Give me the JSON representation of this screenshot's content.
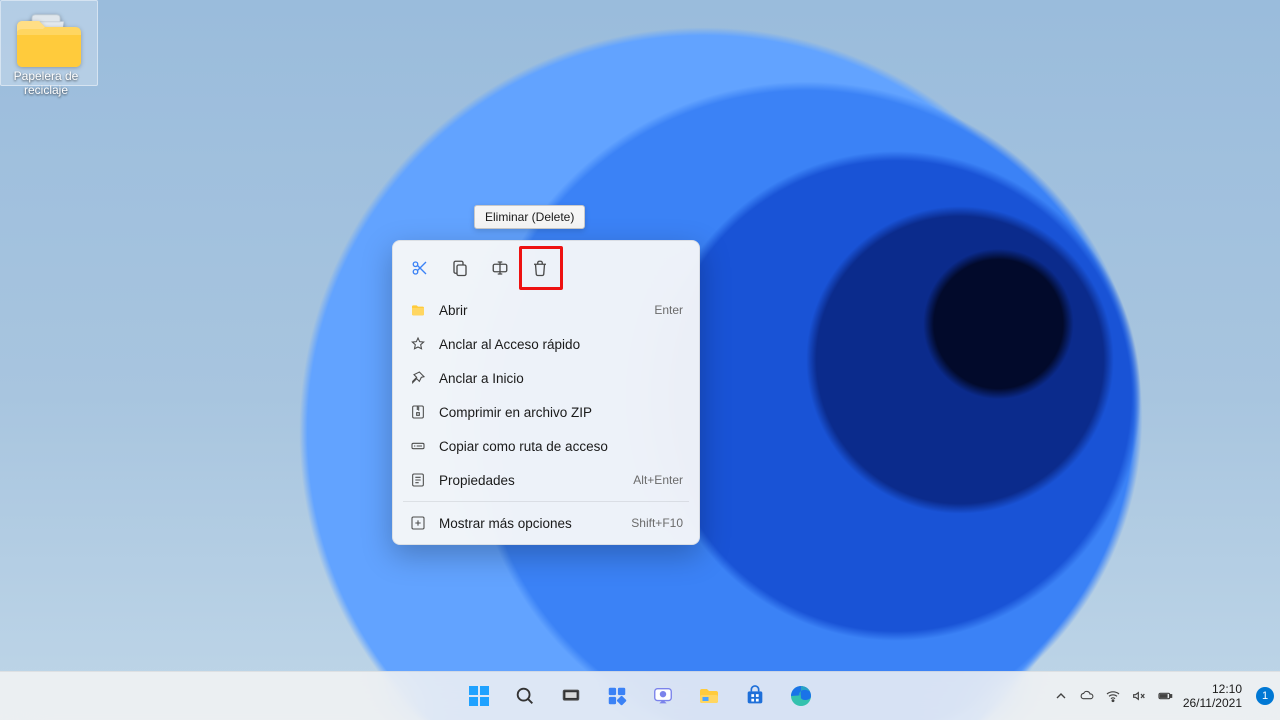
{
  "desktop": {
    "recycle_bin_label": "Papelera de reciclaje"
  },
  "tooltip": {
    "text": "Eliminar (Delete)"
  },
  "context_menu": {
    "top_icons": [
      "cut",
      "copy",
      "rename",
      "delete"
    ],
    "items": [
      {
        "icon": "folder",
        "label": "Abrir",
        "shortcut": "Enter"
      },
      {
        "icon": "star",
        "label": "Anclar al Acceso rápido",
        "shortcut": ""
      },
      {
        "icon": "pin",
        "label": "Anclar a Inicio",
        "shortcut": ""
      },
      {
        "icon": "zip",
        "label": "Comprimir en archivo ZIP",
        "shortcut": ""
      },
      {
        "icon": "path",
        "label": "Copiar como ruta de acceso",
        "shortcut": ""
      },
      {
        "icon": "props",
        "label": "Propiedades",
        "shortcut": "Alt+Enter"
      }
    ],
    "more": {
      "icon": "more",
      "label": "Mostrar más opciones",
      "shortcut": "Shift+F10"
    }
  },
  "taskbar": {
    "apps": [
      "start",
      "search",
      "taskview",
      "widgets",
      "chat",
      "explorer",
      "store",
      "edge"
    ],
    "tray_icons": [
      "chevron-up",
      "onedrive",
      "wifi",
      "volume-mute",
      "battery"
    ],
    "clock": {
      "time": "12:10",
      "date": "26/11/2021"
    },
    "notif_count": "1"
  }
}
